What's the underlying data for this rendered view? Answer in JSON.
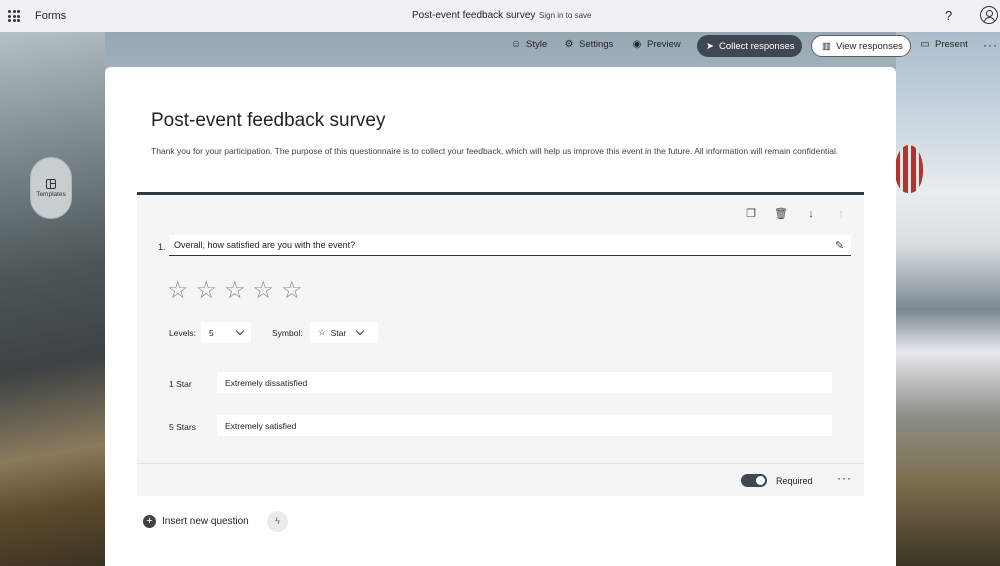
{
  "topbar": {
    "app_name": "Forms",
    "doc_title": "Post-event feedback survey",
    "sign_in": "Sign in to save",
    "help_icon": "?"
  },
  "commands": {
    "style": "Style",
    "settings": "Settings",
    "preview": "Preview",
    "collect": "Collect responses",
    "view_responses": "View responses",
    "present": "Present",
    "more": "···"
  },
  "sidebar": {
    "templates_label": "Templates"
  },
  "form": {
    "title": "Post-event feedback survey",
    "description": "Thank you for your participation. The purpose of this questionnaire is to collect your feedback, which will help us improve this event in the future. All information will remain confidential."
  },
  "question": {
    "number": "1.",
    "text": "Overall, how satisfied are you with the event?",
    "stars": [
      "☆",
      "☆",
      "☆",
      "☆",
      "☆"
    ],
    "levels_label": "Levels:",
    "levels_value": "5",
    "symbol_label": "Symbol:",
    "symbol_icon": "☆",
    "symbol_value": "Star",
    "low_label": "1 Star",
    "low_value": "Extremely dissatisfied",
    "high_label": "5 Stars",
    "high_value": "Extremely satisfied",
    "required_label": "Required",
    "required": true,
    "more": "···"
  },
  "insert": {
    "label": "Insert new question",
    "plus": "+"
  },
  "icons": {
    "copy": "copy-icon",
    "delete": "trash-icon",
    "move_down": "arrow-down-icon",
    "move_up": "arrow-up-icon",
    "edit": "edit-icon",
    "ai": "lightning-icon"
  },
  "colors": {
    "accent": "#3f4850",
    "topbar": "#eef2f5"
  }
}
